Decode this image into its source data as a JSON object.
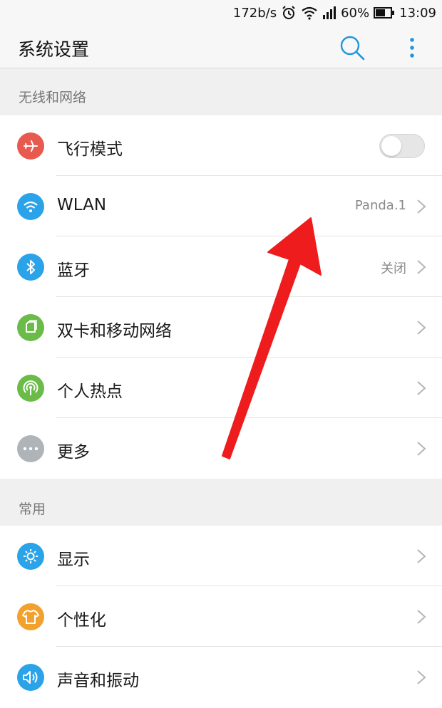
{
  "status_bar": {
    "speed": "172b/s",
    "battery": "60%",
    "time": "13:09",
    "icons": [
      "alarm-icon",
      "wifi-icon",
      "signal-icon",
      "battery-icon"
    ]
  },
  "header": {
    "title": "系统设置",
    "search_icon": "search-icon",
    "menu_icon": "more-vert-icon",
    "accent_color": "#2196d9"
  },
  "sections": [
    {
      "title": "无线和网络",
      "items": [
        {
          "label": "飞行模式",
          "icon": "airplane-icon",
          "color": "#e85a4f",
          "control": "toggle",
          "toggle_on": false
        },
        {
          "label": "WLAN",
          "icon": "wifi-icon",
          "color": "#2ba3e8",
          "value": "Panda.1"
        },
        {
          "label": "蓝牙",
          "icon": "bluetooth-icon",
          "color": "#2ba3e8",
          "value": "关闭"
        },
        {
          "label": "双卡和移动网络",
          "icon": "sim-icon",
          "color": "#6abb48"
        },
        {
          "label": "个人热点",
          "icon": "hotspot-icon",
          "color": "#6abb48"
        },
        {
          "label": "更多",
          "icon": "more-dots-icon",
          "color": "#aeb4b8"
        }
      ]
    },
    {
      "title": "常用",
      "items": [
        {
          "label": "显示",
          "icon": "brightness-icon",
          "color": "#2ba3e8"
        },
        {
          "label": "个性化",
          "icon": "shirt-icon",
          "color": "#f2a12e"
        },
        {
          "label": "声音和振动",
          "icon": "speaker-icon",
          "color": "#2ba3e8"
        }
      ]
    }
  ],
  "annotation": {
    "type": "arrow",
    "color": "#ee1c1c"
  }
}
